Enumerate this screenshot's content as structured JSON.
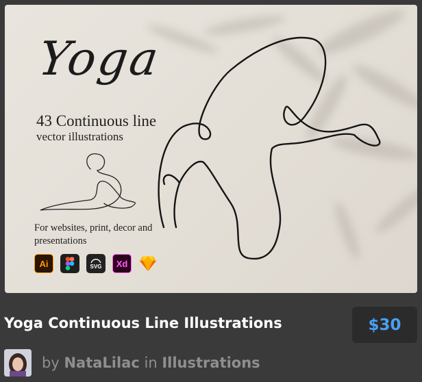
{
  "preview": {
    "script_title": "Yoga",
    "headline": "43 Continuous line",
    "subline": "vector illustrations",
    "uses": "For websites, print, decor and presentations",
    "formats": [
      {
        "label": "Ai",
        "icon": "illustrator-icon"
      },
      {
        "label": "",
        "icon": "figma-icon"
      },
      {
        "label": "SVG",
        "icon": "svg-icon"
      },
      {
        "label": "Xd",
        "icon": "xd-icon"
      },
      {
        "label": "",
        "icon": "sketch-icon"
      }
    ]
  },
  "product": {
    "title": "Yoga Continuous Line Illustrations",
    "price": "$30"
  },
  "author": {
    "by": "by",
    "name": "NataLilac",
    "in": "in",
    "category": "Illustrations"
  },
  "colors": {
    "background": "#3a3a3a",
    "price_text": "#4a9ff0",
    "title_text": "#ffffff",
    "meta_text": "#8f8f8f"
  }
}
